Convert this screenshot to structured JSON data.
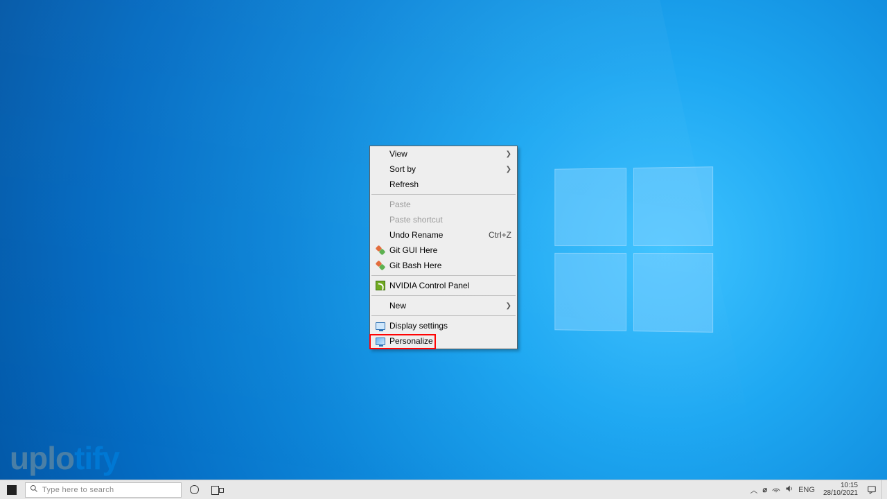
{
  "watermark": {
    "part1": "uplo",
    "part2": "tify"
  },
  "context_menu": {
    "items": {
      "view": {
        "label": "View"
      },
      "sort_by": {
        "label": "Sort by"
      },
      "refresh": {
        "label": "Refresh"
      },
      "paste": {
        "label": "Paste"
      },
      "paste_shortcut": {
        "label": "Paste shortcut"
      },
      "undo_rename": {
        "label": "Undo Rename",
        "accel": "Ctrl+Z"
      },
      "git_gui": {
        "label": "Git GUI Here"
      },
      "git_bash": {
        "label": "Git Bash Here"
      },
      "nvidia": {
        "label": "NVIDIA Control Panel"
      },
      "new": {
        "label": "New"
      },
      "display": {
        "label": "Display settings"
      },
      "personalize": {
        "label": "Personalize"
      }
    }
  },
  "taskbar": {
    "search_placeholder": "Type here to search",
    "language": "ENG",
    "clock": {
      "time": "10:15",
      "date": "28/10/2021"
    }
  }
}
